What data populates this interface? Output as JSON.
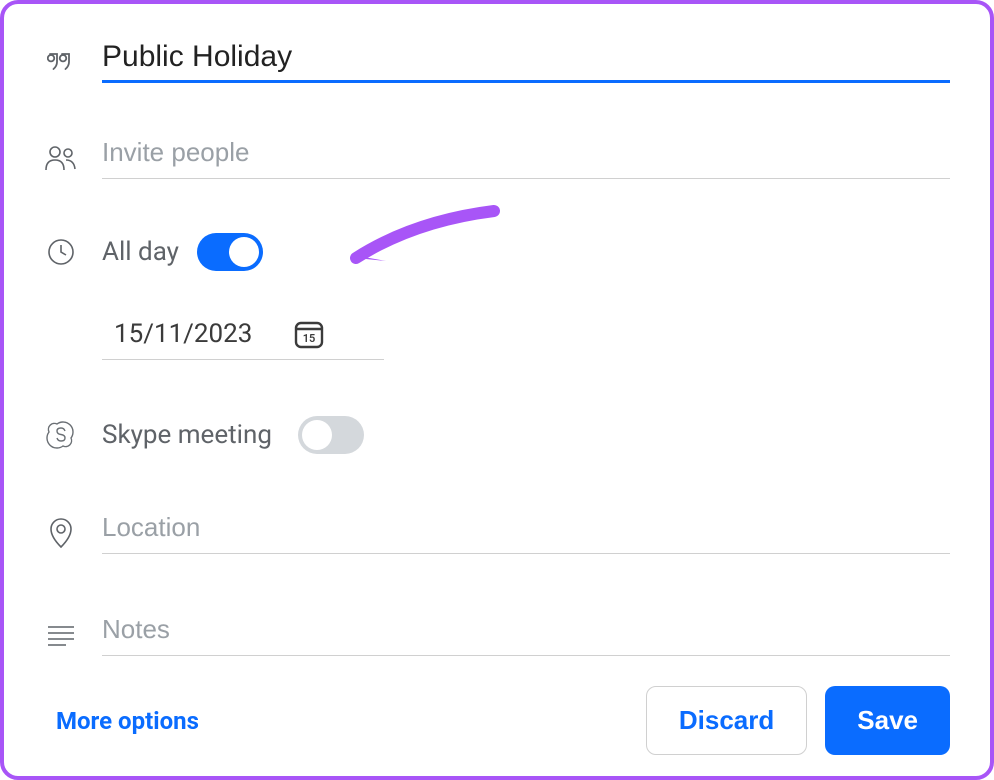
{
  "title": {
    "value": "Public Holiday"
  },
  "invite": {
    "placeholder": "Invite people"
  },
  "allday": {
    "label": "All day",
    "on": true
  },
  "date": {
    "value": "15/11/2023",
    "day_in_icon": "15"
  },
  "skype": {
    "label": "Skype meeting",
    "on": false
  },
  "location": {
    "placeholder": "Location"
  },
  "notes": {
    "placeholder": "Notes"
  },
  "footer": {
    "more_options": "More options",
    "discard": "Discard",
    "save": "Save"
  },
  "colors": {
    "accent": "#0a6cff",
    "frame": "#a855f7",
    "arrow": "#a855f7"
  }
}
